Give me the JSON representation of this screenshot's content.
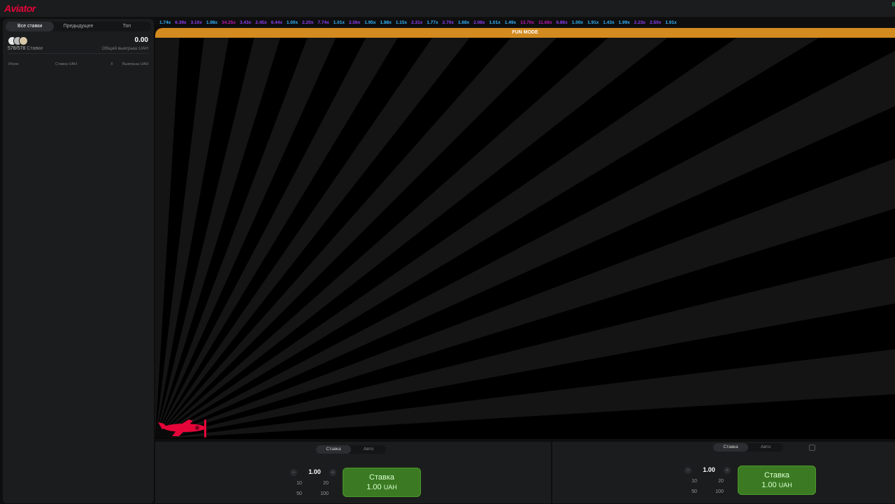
{
  "app": {
    "logo": "Aviator",
    "corner_value": "8"
  },
  "left_panel": {
    "tabs": [
      "Все ставки",
      "Предыдущее",
      "Топ"
    ],
    "bets_count": "578/578",
    "bets_label": "Ставки",
    "total_win": "0.00",
    "total_win_label": "Общий выигрыш UAH",
    "columns": [
      "Игрок",
      "Ставка UAH",
      "X",
      "Выигрыш UAH"
    ]
  },
  "history": [
    {
      "v": "1.74x",
      "c": "#34b4ff"
    },
    {
      "v": "6.39x",
      "c": "#913ef8"
    },
    {
      "v": "3.10x",
      "c": "#913ef8"
    },
    {
      "v": "1.98x",
      "c": "#34b4ff"
    },
    {
      "v": "34.25x",
      "c": "#c017b4"
    },
    {
      "v": "3.43x",
      "c": "#913ef8"
    },
    {
      "v": "2.45x",
      "c": "#913ef8"
    },
    {
      "v": "6.44x",
      "c": "#913ef8"
    },
    {
      "v": "1.00x",
      "c": "#34b4ff"
    },
    {
      "v": "2.20x",
      "c": "#913ef8"
    },
    {
      "v": "7.74x",
      "c": "#913ef8"
    },
    {
      "v": "1.01x",
      "c": "#34b4ff"
    },
    {
      "v": "2.56x",
      "c": "#913ef8"
    },
    {
      "v": "1.95x",
      "c": "#34b4ff"
    },
    {
      "v": "1.88x",
      "c": "#34b4ff"
    },
    {
      "v": "1.15x",
      "c": "#34b4ff"
    },
    {
      "v": "2.31x",
      "c": "#913ef8"
    },
    {
      "v": "1.77x",
      "c": "#34b4ff"
    },
    {
      "v": "2.70x",
      "c": "#913ef8"
    },
    {
      "v": "1.68x",
      "c": "#34b4ff"
    },
    {
      "v": "2.08x",
      "c": "#913ef8"
    },
    {
      "v": "1.01x",
      "c": "#34b4ff"
    },
    {
      "v": "1.49x",
      "c": "#34b4ff"
    },
    {
      "v": "13.70x",
      "c": "#c017b4"
    },
    {
      "v": "11.68x",
      "c": "#c017b4"
    },
    {
      "v": "6.86x",
      "c": "#913ef8"
    },
    {
      "v": "1.00x",
      "c": "#34b4ff"
    },
    {
      "v": "1.91x",
      "c": "#34b4ff"
    },
    {
      "v": "1.43x",
      "c": "#34b4ff"
    },
    {
      "v": "1.99x",
      "c": "#34b4ff"
    },
    {
      "v": "2.23x",
      "c": "#913ef8"
    },
    {
      "v": "2.50x",
      "c": "#913ef8"
    },
    {
      "v": "1.91x",
      "c": "#34b4ff"
    }
  ],
  "game": {
    "mode_banner": "FUN MODE",
    "accent": "#d38a1f",
    "plane_color": "#e50539"
  },
  "bet1": {
    "switch": [
      "Ставка",
      "Авто"
    ],
    "stake": "1.00",
    "minus": "−",
    "plus": "+",
    "quick": [
      "10",
      "20",
      "50",
      "100"
    ],
    "button_label": "Ставка",
    "button_amount": "1.00",
    "currency": "UAH"
  },
  "bet2": {
    "switch": [
      "Ставка",
      "Авто"
    ],
    "stake": "1.00",
    "minus": "−",
    "plus": "+",
    "quick": [
      "10",
      "20",
      "50",
      "100"
    ],
    "button_label": "Ставка",
    "button_amount": "1.00",
    "currency": "UAH"
  }
}
